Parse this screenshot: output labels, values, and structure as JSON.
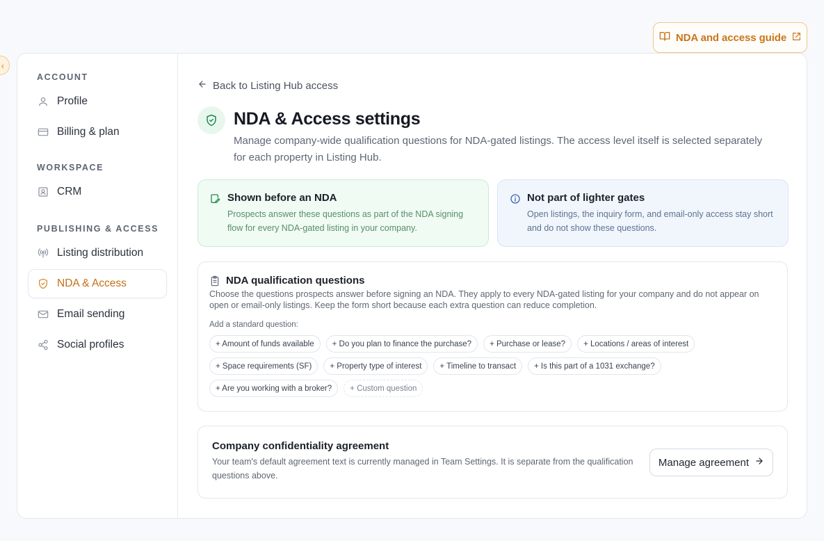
{
  "header": {
    "guide_label": "NDA and access guide",
    "guide_icon": "book-open-icon",
    "external_icon": "external-link-icon"
  },
  "colors": {
    "accent": "#c9761b",
    "accent_border": "#f0c68a",
    "success": "#1f8a4c",
    "info": "#3966b9"
  },
  "sidebar": {
    "sections": [
      {
        "label": "ACCOUNT",
        "items": [
          {
            "label": "Profile",
            "icon": "user-icon",
            "active": false
          },
          {
            "label": "Billing & plan",
            "icon": "credit-card-icon",
            "active": false
          }
        ]
      },
      {
        "label": "WORKSPACE",
        "items": [
          {
            "label": "CRM",
            "icon": "contact-icon",
            "active": false
          }
        ]
      },
      {
        "label": "PUBLISHING & ACCESS",
        "items": [
          {
            "label": "Listing distribution",
            "icon": "broadcast-icon",
            "active": false
          },
          {
            "label": "NDA & Access",
            "icon": "shield-icon",
            "active": true
          },
          {
            "label": "Email sending",
            "icon": "mail-icon",
            "active": false
          },
          {
            "label": "Social profiles",
            "icon": "share-icon",
            "active": false
          }
        ]
      }
    ]
  },
  "main": {
    "back_label": "Back to Listing Hub access",
    "title": "NDA & Access settings",
    "description": "Manage company-wide qualification questions for NDA-gated listings. The access level itself is selected separately for each property in Listing Hub.",
    "cards": [
      {
        "title": "Shown before an NDA",
        "text": "Prospects answer these questions as part of the NDA signing flow for every NDA-gated listing in your company.",
        "icon": "edit-note-icon"
      },
      {
        "title": "Not part of lighter gates",
        "text": "Open listings, the inquiry form, and email-only access stay short and do not show these questions.",
        "icon": "info-icon"
      }
    ],
    "questions": {
      "title": "NDA qualification questions",
      "description": "Choose the questions prospects answer before signing an NDA. They apply to every NDA-gated listing for your company and do not appear on open or email-only listings. Keep the form short because each extra question can reduce completion.",
      "add_label": "Add a standard question:",
      "chips": [
        "+ Amount of funds available",
        "+ Do you plan to finance the purchase?",
        "+ Purchase or lease?",
        "+ Locations / areas of interest",
        "+ Space requirements (SF)",
        "+ Property type of interest",
        "+ Timeline to transact",
        "+ Is this part of a 1031 exchange?",
        "+ Are you working with a broker?"
      ],
      "custom_label": "+ Custom question"
    },
    "agreement": {
      "title": "Company confidentiality agreement",
      "text": "Your team's default agreement text is currently managed in Team Settings. It is separate from the qualification questions above.",
      "button_label": "Manage agreement"
    }
  }
}
